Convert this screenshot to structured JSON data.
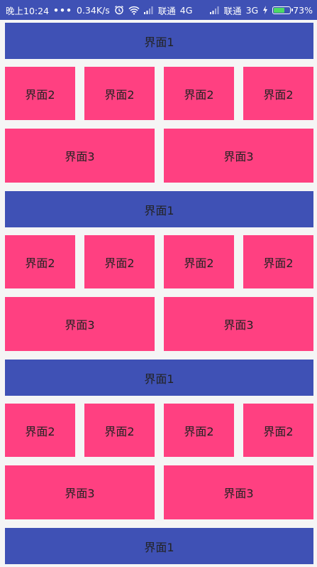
{
  "status_bar": {
    "time": "晚上10:24",
    "dots": "•••",
    "speed": "0.34K/s",
    "carrier1": "联通",
    "network1": "4G",
    "carrier2": "联通",
    "network2": "3G",
    "battery_percent": "73%",
    "battery_level": 0.73,
    "colors": {
      "bar": "#3f51b5",
      "battery_fill": "#4cd964"
    },
    "icons": [
      "alarm-icon",
      "wifi-icon",
      "signal-icon",
      "signal-icon",
      "charging-icon"
    ]
  },
  "grid": {
    "colors": {
      "tile1": "#3f51b5",
      "tile2": "#ff4081",
      "tile3": "#ff4081"
    },
    "sections": [
      {
        "tile1": "界面1",
        "tile2": [
          "界面2",
          "界面2",
          "界面2",
          "界面2"
        ],
        "tile3": [
          "界面3",
          "界面3"
        ]
      },
      {
        "tile1": "界面1",
        "tile2": [
          "界面2",
          "界面2",
          "界面2",
          "界面2"
        ],
        "tile3": [
          "界面3",
          "界面3"
        ]
      },
      {
        "tile1": "界面1",
        "tile2": [
          "界面2",
          "界面2",
          "界面2",
          "界面2"
        ],
        "tile3": [
          "界面3",
          "界面3"
        ]
      }
    ],
    "last_tile1": "界面1"
  }
}
